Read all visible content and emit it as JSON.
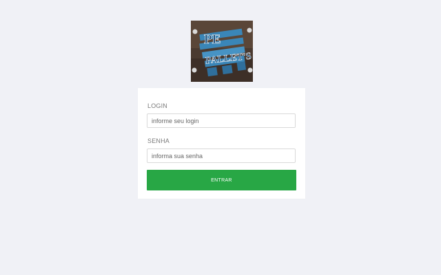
{
  "logo": {
    "line1": "PE",
    "line2": "PALLET'S",
    "colors": {
      "background": "#4a3a30",
      "pallet": "#3a86b8",
      "text": "#1f4e79"
    }
  },
  "form": {
    "login_label": "LOGIN",
    "login_placeholder": "informe seu login",
    "senha_label": "SENHA",
    "senha_placeholder": "informa sua senha",
    "submit_label": "ENTRAR"
  },
  "colors": {
    "page_background": "#f0f1f6",
    "card_background": "#ffffff",
    "submit_background": "#28a745"
  }
}
